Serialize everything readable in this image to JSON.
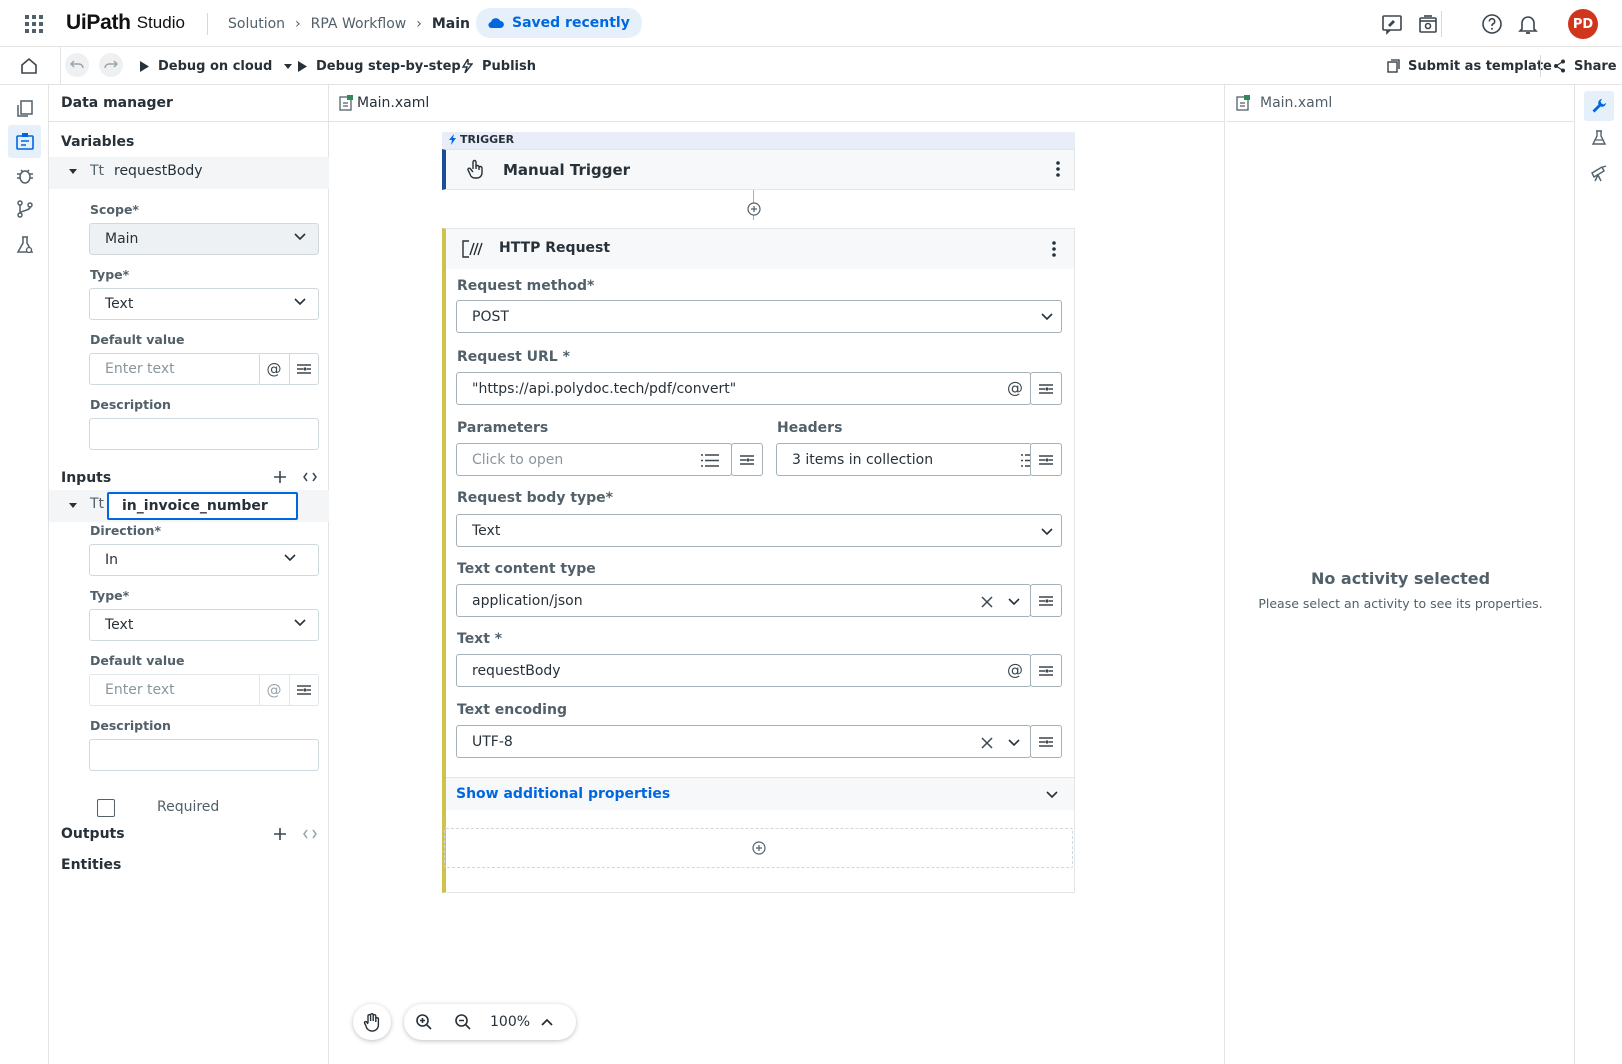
{
  "header": {
    "logo_brand": "UiPath",
    "logo_product": "Studio",
    "breadcrumb": [
      "Solution",
      "RPA Workflow",
      "Main"
    ],
    "saved_status": "Saved recently",
    "avatar_initials": "PD",
    "avatar_color": "#d0361d"
  },
  "toolbar": {
    "debug_cloud_label": "Debug on cloud",
    "debug_step_label": "Debug step-by-step",
    "publish_label": "Publish",
    "submit_template_label": "Submit as template",
    "share_label": "Share"
  },
  "data_manager": {
    "title": "Data manager",
    "variables_title": "Variables",
    "variable": {
      "type_glyph": "Tt",
      "name": "requestBody",
      "scope_label": "Scope*",
      "scope_value": "Main",
      "type_label": "Type*",
      "type_value": "Text",
      "default_label": "Default value",
      "default_placeholder": "Enter text",
      "description_label": "Description"
    },
    "inputs_title": "Inputs",
    "input": {
      "type_glyph": "Tt",
      "name": "in_invoice_number",
      "direction_label": "Direction*",
      "direction_value": "In",
      "type_label": "Type*",
      "type_value": "Text",
      "default_label": "Default value",
      "default_placeholder": "Enter text",
      "description_label": "Description",
      "required_label": "Required"
    },
    "outputs_title": "Outputs",
    "entities_title": "Entities"
  },
  "canvas": {
    "tab_label": "Main.xaml",
    "trigger_tag": "TRIGGER",
    "trigger_title": "Manual Trigger",
    "http_title": "HTTP Request",
    "request_method_label": "Request method*",
    "request_method_value": "POST",
    "request_url_label": "Request URL *",
    "request_url_value": "\"https://api.polydoc.tech/pdf/convert\"",
    "parameters_label": "Parameters",
    "parameters_placeholder": "Click to open",
    "headers_label": "Headers",
    "headers_value": "3 items in collection",
    "body_type_label": "Request body type*",
    "body_type_value": "Text",
    "content_type_label": "Text content type",
    "content_type_value": "application/json",
    "text_label": "Text *",
    "text_value": "requestBody",
    "encoding_label": "Text encoding",
    "encoding_value": "UTF-8",
    "show_more_label": "Show additional properties",
    "zoom_level": "100%"
  },
  "properties": {
    "tab_label": "Main.xaml",
    "empty_title": "No activity selected",
    "empty_subtitle": "Please select an activity to see its properties."
  },
  "colors": {
    "accent": "#0067df",
    "trigger_bar": "#1b4b9b",
    "activity_bar": "#cfc24a"
  }
}
